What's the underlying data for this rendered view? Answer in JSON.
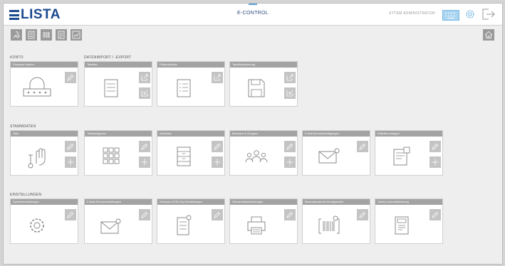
{
  "header": {
    "logo_text": "LISTA",
    "app_title": "E-CONTROL",
    "user": "SYTEM ADMINISTRATOR",
    "icons": [
      "keyboard-icon",
      "settings-icon",
      "logout-icon"
    ]
  },
  "toolbar": {
    "icons": [
      "tool-icon",
      "list-icon",
      "barcode-icon",
      "document-icon",
      "chart-icon"
    ],
    "home_icon": "home-icon"
  },
  "sections": {
    "konto": "KONTO",
    "datenimport": "DATENIMPORT / -EXPORT",
    "stammdaten": "STAMMDATEN",
    "einstellungen": "EINSTELLUNGEN"
  },
  "cards": {
    "passwort": "Passwort ändern",
    "tabellen": "Tabellen",
    "pruefprotokolle": "Prüfprotokolle",
    "tabellensicherung": "Tabellensicherung",
    "teile": "Teile",
    "teilekategorien": "Teilekategorien",
    "schraenke": "Schränke",
    "benutzer": "Benutzer & Gruppen",
    "email_benachrichtigungen": "E-Mail-Benachrichtigungen",
    "etikettenvorlagen": "Etikettenvorlagen",
    "systemeinstellungen": "Systemeinstellungen",
    "email_servereinstellungen": "E-Mail-Servereinstellungen",
    "schrank_einstellungen": "Schrank-LISTA Key-Einstellungen",
    "sicherheitseinstellungen": "Sicherheitseinstellungen",
    "barcodescanner": "Barcodescanner-Konfiguration",
    "online_lizenz": "Online-Lizenzaktivierung"
  },
  "colors": {
    "brand": "#1a4a8f",
    "card_header": "#a3a3a3",
    "accent": "#5fa0d8"
  }
}
